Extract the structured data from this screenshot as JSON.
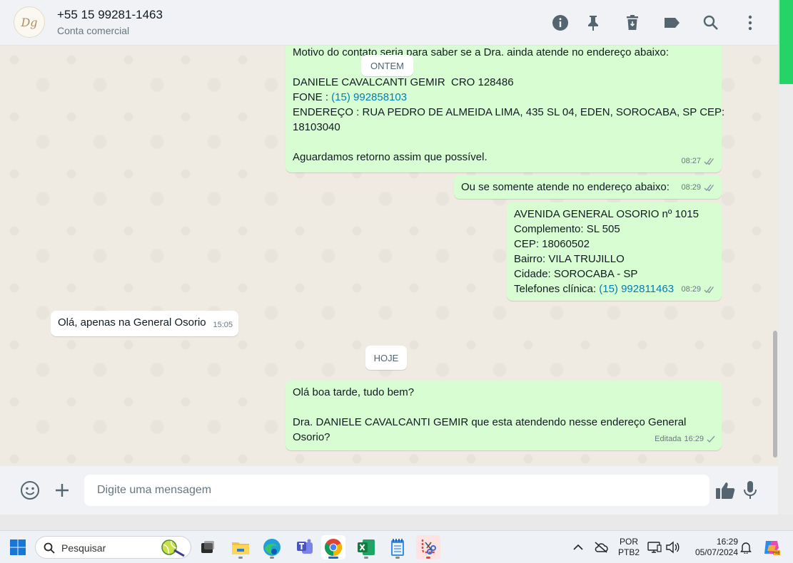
{
  "header": {
    "avatar_text": "Dg",
    "contact_name": "+55 15 99281-1463",
    "contact_subtitle": "Conta comercial",
    "icons": [
      "info-icon",
      "pin-icon",
      "delete-icon",
      "label-icon",
      "search-icon",
      "menu-icon"
    ]
  },
  "chat": {
    "day_yesterday": "ONTEM",
    "day_today": "HOJE",
    "msg1": {
      "line1": "Motivo do contato seria para saber se a Dra. ainda atende no endereço abaixo:",
      "line2": "DANIELE CAVALCANTI GEMIR  CRO 128486",
      "line3_prefix": "FONE : ",
      "line3_link": "(15) 992858103",
      "line4": "ENDEREÇO : RUA PEDRO DE ALMEIDA LIMA, 435 SL 04, EDEN, SOROCABA, SP CEP:",
      "line5": "18103040",
      "line6": "Aguardamos retorno assim que possível.",
      "time": "08:27"
    },
    "msg2": {
      "text": "Ou se somente atende no endereço abaixo:",
      "time": "08:29"
    },
    "msg3": {
      "line1": "AVENIDA GENERAL OSORIO nº 1015",
      "line2": "Complemento: SL 505",
      "line3": "CEP: 18060502",
      "line4": "Bairro: VILA TRUJILLO",
      "line5": "Cidade: SOROCABA - SP",
      "line6_prefix": "Telefones clínica: ",
      "line6_link": "(15) 992811463",
      "time": "08:29"
    },
    "msg4": {
      "text": "Olá, apenas na General Osorio",
      "time": "15:05"
    },
    "msg5": {
      "line1": "Olá boa tarde, tudo bem?",
      "line2": "Dra. DANIELE CAVALCANTI GEMIR que esta atendendo nesse endereço General",
      "line3": "Osorio?",
      "edited": "Editada",
      "time": "16:29"
    }
  },
  "composer": {
    "placeholder": "Digite uma mensagem",
    "value": ""
  },
  "taskbar": {
    "search_placeholder": "Pesquisar",
    "lang_top": "POR",
    "lang_bottom": "PTB2",
    "time": "16:29",
    "date": "05/07/2024",
    "apps": [
      "task-view",
      "file-explorer",
      "edge",
      "teams",
      "chrome",
      "excel",
      "notepad",
      "snipping-tool"
    ]
  },
  "colors": {
    "outgoing_bubble": "#d9fdd3",
    "incoming_bubble": "#ffffff",
    "chat_background": "#efeae2",
    "link": "#027eb5",
    "accent_green": "#25d366"
  }
}
